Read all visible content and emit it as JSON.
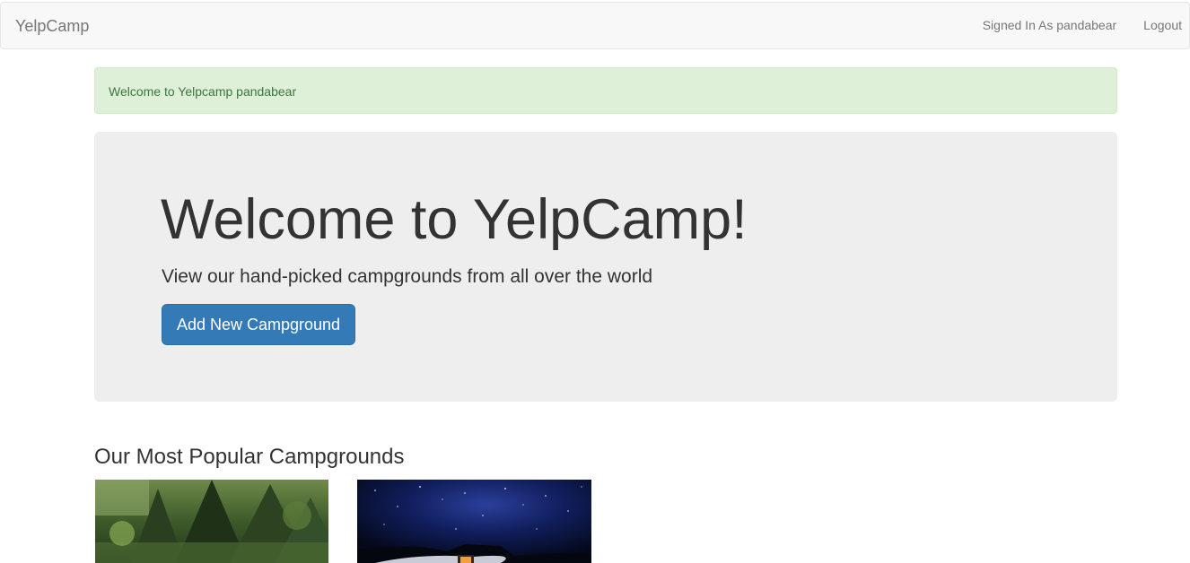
{
  "navbar": {
    "brand": "YelpCamp",
    "signed_in": "Signed In As pandabear",
    "logout": "Logout"
  },
  "alert": {
    "message": "Welcome to Yelpcamp pandabear"
  },
  "jumbotron": {
    "title": "Welcome to YelpCamp!",
    "subtitle": "View our hand-picked campgrounds from all over the world",
    "button_label": "Add New Campground"
  },
  "section": {
    "title": "Our Most Popular Campgrounds"
  },
  "colors": {
    "primary": "#337ab7",
    "alert_bg": "#dff0d8",
    "alert_text": "#3c763d",
    "jumbotron_bg": "#eeeeee",
    "navbar_bg": "#f8f8f8"
  },
  "campgrounds": [
    {
      "image": "forest-campground-image"
    },
    {
      "image": "night-sky-campground-image"
    }
  ]
}
